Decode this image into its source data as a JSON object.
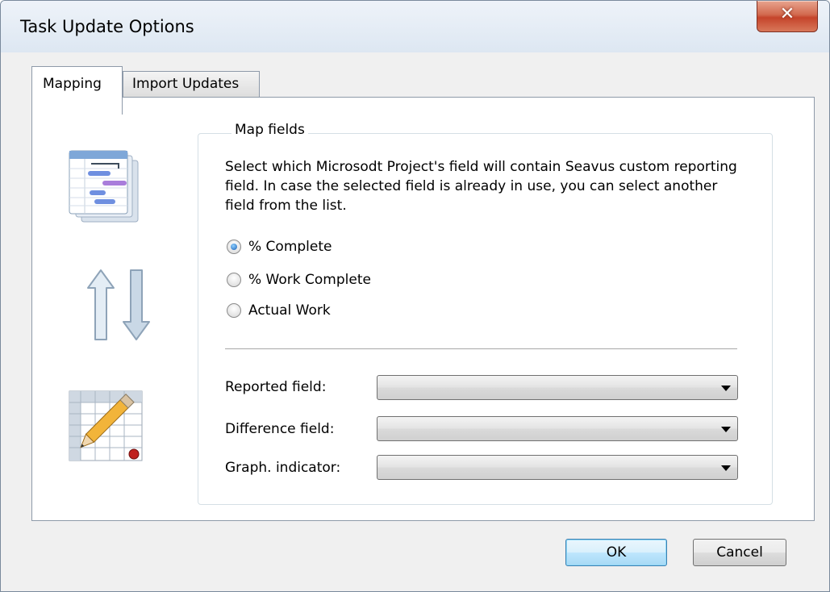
{
  "window": {
    "title": "Task Update Options",
    "close_glyph": "✕"
  },
  "tabs": [
    {
      "label": "Mapping",
      "active": true
    },
    {
      "label": "Import Updates",
      "active": false
    }
  ],
  "icons": {
    "top": "gantt-chart-icon",
    "middle": "up-down-arrows-icon",
    "bottom": "grid-edit-pencil-icon"
  },
  "map_fields": {
    "legend": "Map fields",
    "description": "Select which Microsodt Project's field will contain Seavus custom reporting field. In case the selected field is already in use, you can select another field from the list.",
    "options": [
      {
        "label": "% Complete",
        "selected": true
      },
      {
        "label": "% Work Complete",
        "selected": false
      },
      {
        "label": "Actual Work",
        "selected": false
      }
    ],
    "fields": [
      {
        "label": "Reported field:",
        "value": ""
      },
      {
        "label": "Difference field:",
        "value": ""
      },
      {
        "label": "Graph. indicator:",
        "value": ""
      }
    ]
  },
  "buttons": {
    "ok": "OK",
    "cancel": "Cancel"
  },
  "colors": {
    "accent_blue": "#3c7fb1",
    "close_red": "#c5442b",
    "gantt_bar_blue": "#6f8fe0",
    "gantt_bar_purple": "#a97ddb"
  }
}
